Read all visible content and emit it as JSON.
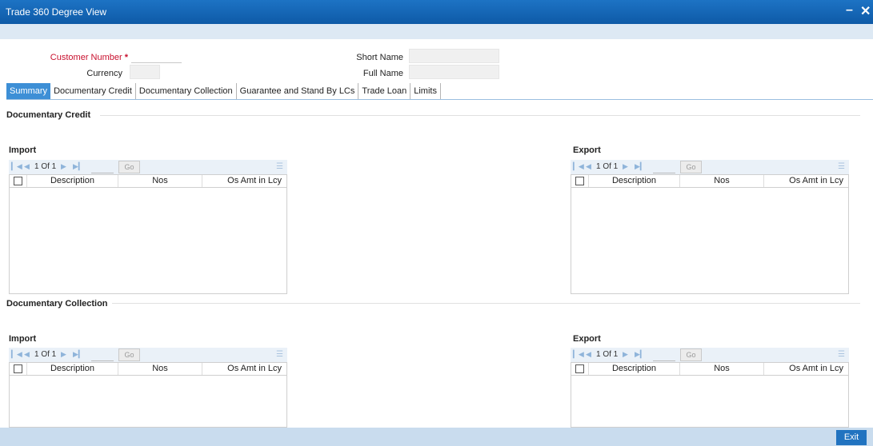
{
  "window": {
    "title": "Trade 360 Degree View",
    "minimize_glyph": "–",
    "close_glyph": "✕"
  },
  "header": {
    "customer_number_label": "Customer Number",
    "required_mark": "*",
    "currency_label": "Currency",
    "short_name_label": "Short Name",
    "full_name_label": "Full Name",
    "customer_number_value": "",
    "currency_value": "",
    "short_name_value": "",
    "full_name_value": ""
  },
  "tabs": [
    {
      "label": "Summary",
      "active": true
    },
    {
      "label": "Documentary Credit"
    },
    {
      "label": "Documentary Collection"
    },
    {
      "label": "Guarantee and Stand By LCs"
    },
    {
      "label": "Trade Loan"
    },
    {
      "label": "Limits"
    }
  ],
  "sections": {
    "documentary_credit": {
      "title": "Documentary Credit",
      "import": {
        "title": "Import",
        "pagination": "1 Of 1",
        "go": "Go",
        "columns": [
          "Description",
          "Nos",
          "Os Amt in Lcy"
        ]
      },
      "export": {
        "title": "Export",
        "pagination": "1 Of 1",
        "go": "Go",
        "columns": [
          "Description",
          "Nos",
          "Os Amt in Lcy"
        ]
      }
    },
    "documentary_collection": {
      "title": "Documentary Collection",
      "import": {
        "title": "Import",
        "pagination": "1 Of 1",
        "go": "Go",
        "columns": [
          "Description",
          "Nos",
          "Os Amt in Lcy"
        ]
      },
      "export": {
        "title": "Export",
        "pagination": "1 Of 1",
        "go": "Go",
        "columns": [
          "Description",
          "Nos",
          "Os Amt in Lcy"
        ]
      }
    }
  },
  "footer": {
    "exit_label": "Exit"
  },
  "icons": {
    "first_page": "first-page-icon",
    "prev_page": "prev-page-icon",
    "next_page": "next-page-icon",
    "last_page": "last-page-icon",
    "grid_menu": "grid-menu-icon"
  },
  "colors": {
    "titlebar": "#1565b5",
    "active_tab": "#3d8fd6",
    "required": "#c8102e",
    "exit_button": "#2173c0",
    "footer": "#c9dcee"
  }
}
